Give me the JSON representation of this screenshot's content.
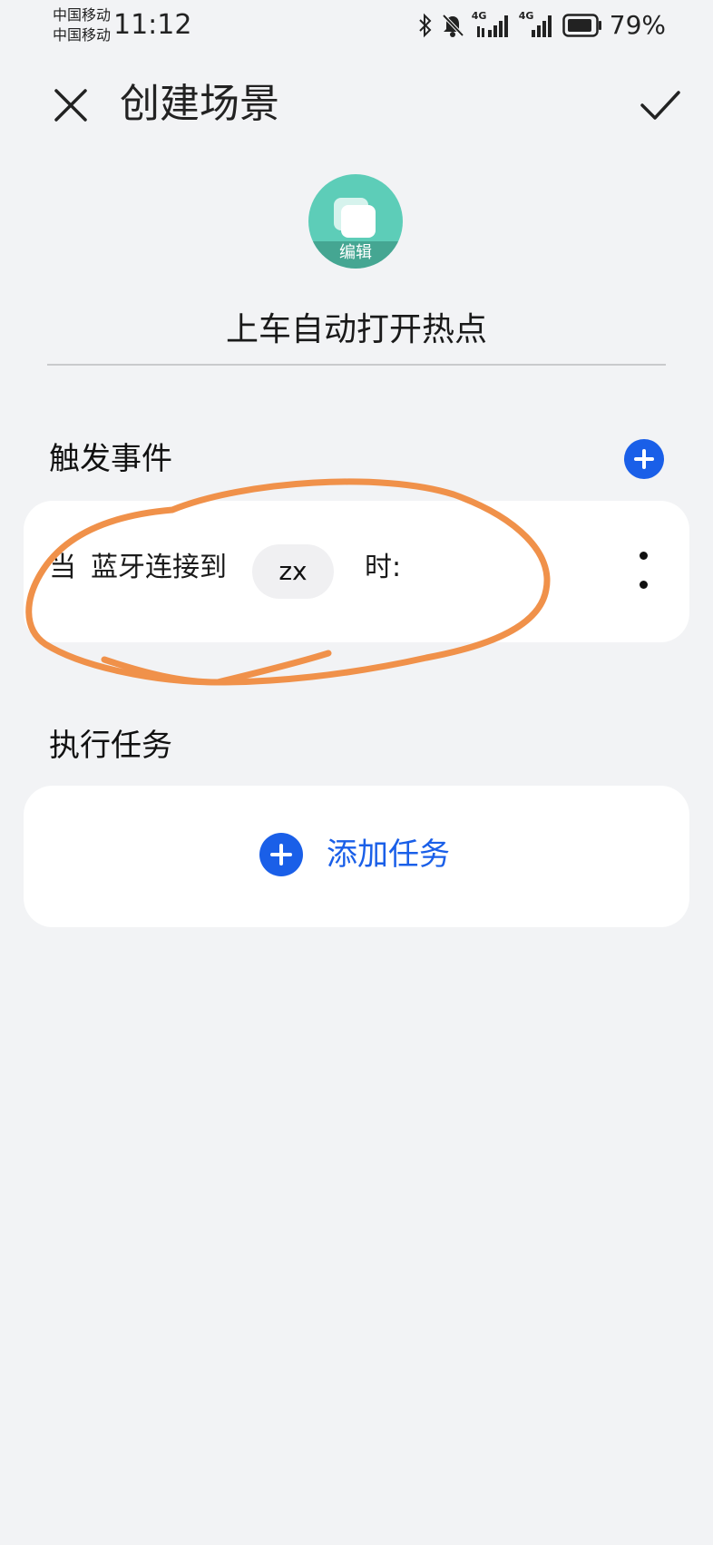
{
  "status_bar": {
    "carrier_1": "中国移动",
    "carrier_2": "中国移动",
    "time": "11:12",
    "network_1": "4G",
    "network_2": "4G",
    "battery": "79%"
  },
  "header": {
    "title": "创建场景"
  },
  "scene": {
    "avatar_edit_label": "编辑",
    "name": "上车自动打开热点"
  },
  "trigger_section": {
    "title": "触发事件",
    "condition": {
      "prefix": "当",
      "event": "蓝牙连接到",
      "device": "zx",
      "suffix": "时:"
    }
  },
  "task_section": {
    "title": "执行任务",
    "add_label": "添加任务"
  },
  "colors": {
    "accent": "#1a5fe8",
    "avatar": "#5dcdb8",
    "background": "#f2f3f5",
    "annotation": "#f0914a"
  }
}
